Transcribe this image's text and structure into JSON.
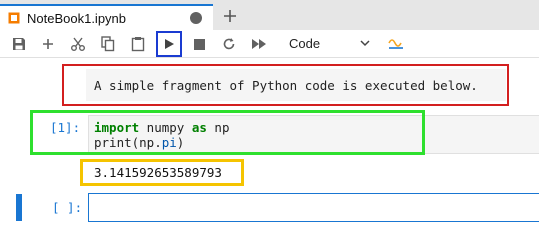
{
  "tab": {
    "title": "NoteBook1.ipynb",
    "icon": "notebook-icon"
  },
  "toolbar": {
    "buttons": [
      "save-icon",
      "add-cell-icon",
      "cut-icon",
      "copy-icon",
      "paste-icon",
      "run-icon",
      "stop-icon",
      "restart-icon",
      "fast-forward-icon"
    ],
    "cell_type": "Code",
    "accent": "#1976d2"
  },
  "cells": {
    "markdown": {
      "text": "A simple fragment of Python code is executed below."
    },
    "code": {
      "prompt": "[1]:",
      "lines": [
        {
          "kw1": "import",
          "mid": " numpy ",
          "kw2": "as",
          "end": " np"
        },
        {
          "prefix": "print(np.",
          "prop": "pi",
          "suffix": ")"
        }
      ]
    },
    "output": {
      "text": "3.141592653589793"
    },
    "empty": {
      "prompt": "[ ]:"
    }
  },
  "highlight_colors": {
    "markdown": "#d31f1f",
    "code": "#2ee02e",
    "output": "#f5c400",
    "run_button": "#1a3bd1"
  }
}
